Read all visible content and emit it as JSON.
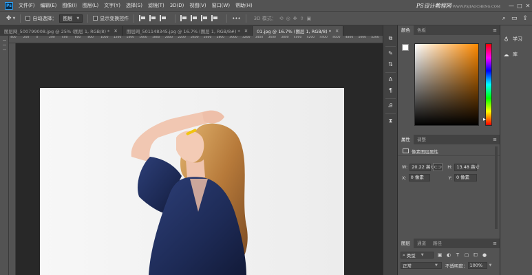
{
  "menubar": {
    "app_icon": "Ps",
    "items": [
      "文件(F)",
      "编辑(E)",
      "图像(I)",
      "图层(L)",
      "文字(Y)",
      "选择(S)",
      "滤镜(T)",
      "3D(D)",
      "视图(V)",
      "窗口(W)",
      "帮助(H)"
    ],
    "watermark": "PS设计教程网",
    "watermark_sub": "WWW.PSJIAOCHENG.COM",
    "window_controls": [
      "—",
      "□",
      "✕"
    ]
  },
  "options": {
    "move_icon": "move-tool-icon",
    "auto_select_label": "自动选择：",
    "auto_select_target": "图层",
    "show_transform_label": "显示变换控件",
    "more_label": "•••",
    "mode_3d_label": "3D 模式："
  },
  "tabs": [
    {
      "label": "图层网_500799008.jpg @ 25% (图层 1, RGB/8) *",
      "active": false
    },
    {
      "label": "图层网_501148345.jpg @ 16.7% (图层 1, RGB/8#) *",
      "active": false
    },
    {
      "label": "01.jpg @ 16.7% (图层 1, RGB/8) *",
      "active": true
    }
  ],
  "ruler": {
    "ticks": [
      "400",
      "200",
      "0",
      "200",
      "400",
      "600",
      "800",
      "1000",
      "1200",
      "1400",
      "1600",
      "1800",
      "2000",
      "2200",
      "2400",
      "2600",
      "2800",
      "3000",
      "3200",
      "3400",
      "3600",
      "3800",
      "4000",
      "4200",
      "4400",
      "4600",
      "4800",
      "5000",
      "5200"
    ]
  },
  "color_panel": {
    "tabs": [
      "颜色",
      "色板"
    ],
    "foreground": "#ffffff",
    "background": "#000000",
    "picker_hue": "#ff8a00"
  },
  "properties_panel": {
    "tabs": [
      "属性",
      "调整"
    ],
    "subtitle": "像素图层属性",
    "w_label": "W:",
    "w_value": "20.22 英寸",
    "h_label": "H:",
    "h_value": "13.48 英寸",
    "x_label": "X:",
    "x_value": "0 像素",
    "y_label": "Y:",
    "y_value": "0 像素",
    "link_icon": "link-icon"
  },
  "layers_panel": {
    "tabs": [
      "图层",
      "通道",
      "路径"
    ],
    "filter_label": "类型",
    "blend_mode": "正常",
    "opacity_label": "不透明度：",
    "opacity_value": "100%"
  },
  "right_dock": {
    "learn_label": "学习",
    "library_label": "库"
  }
}
